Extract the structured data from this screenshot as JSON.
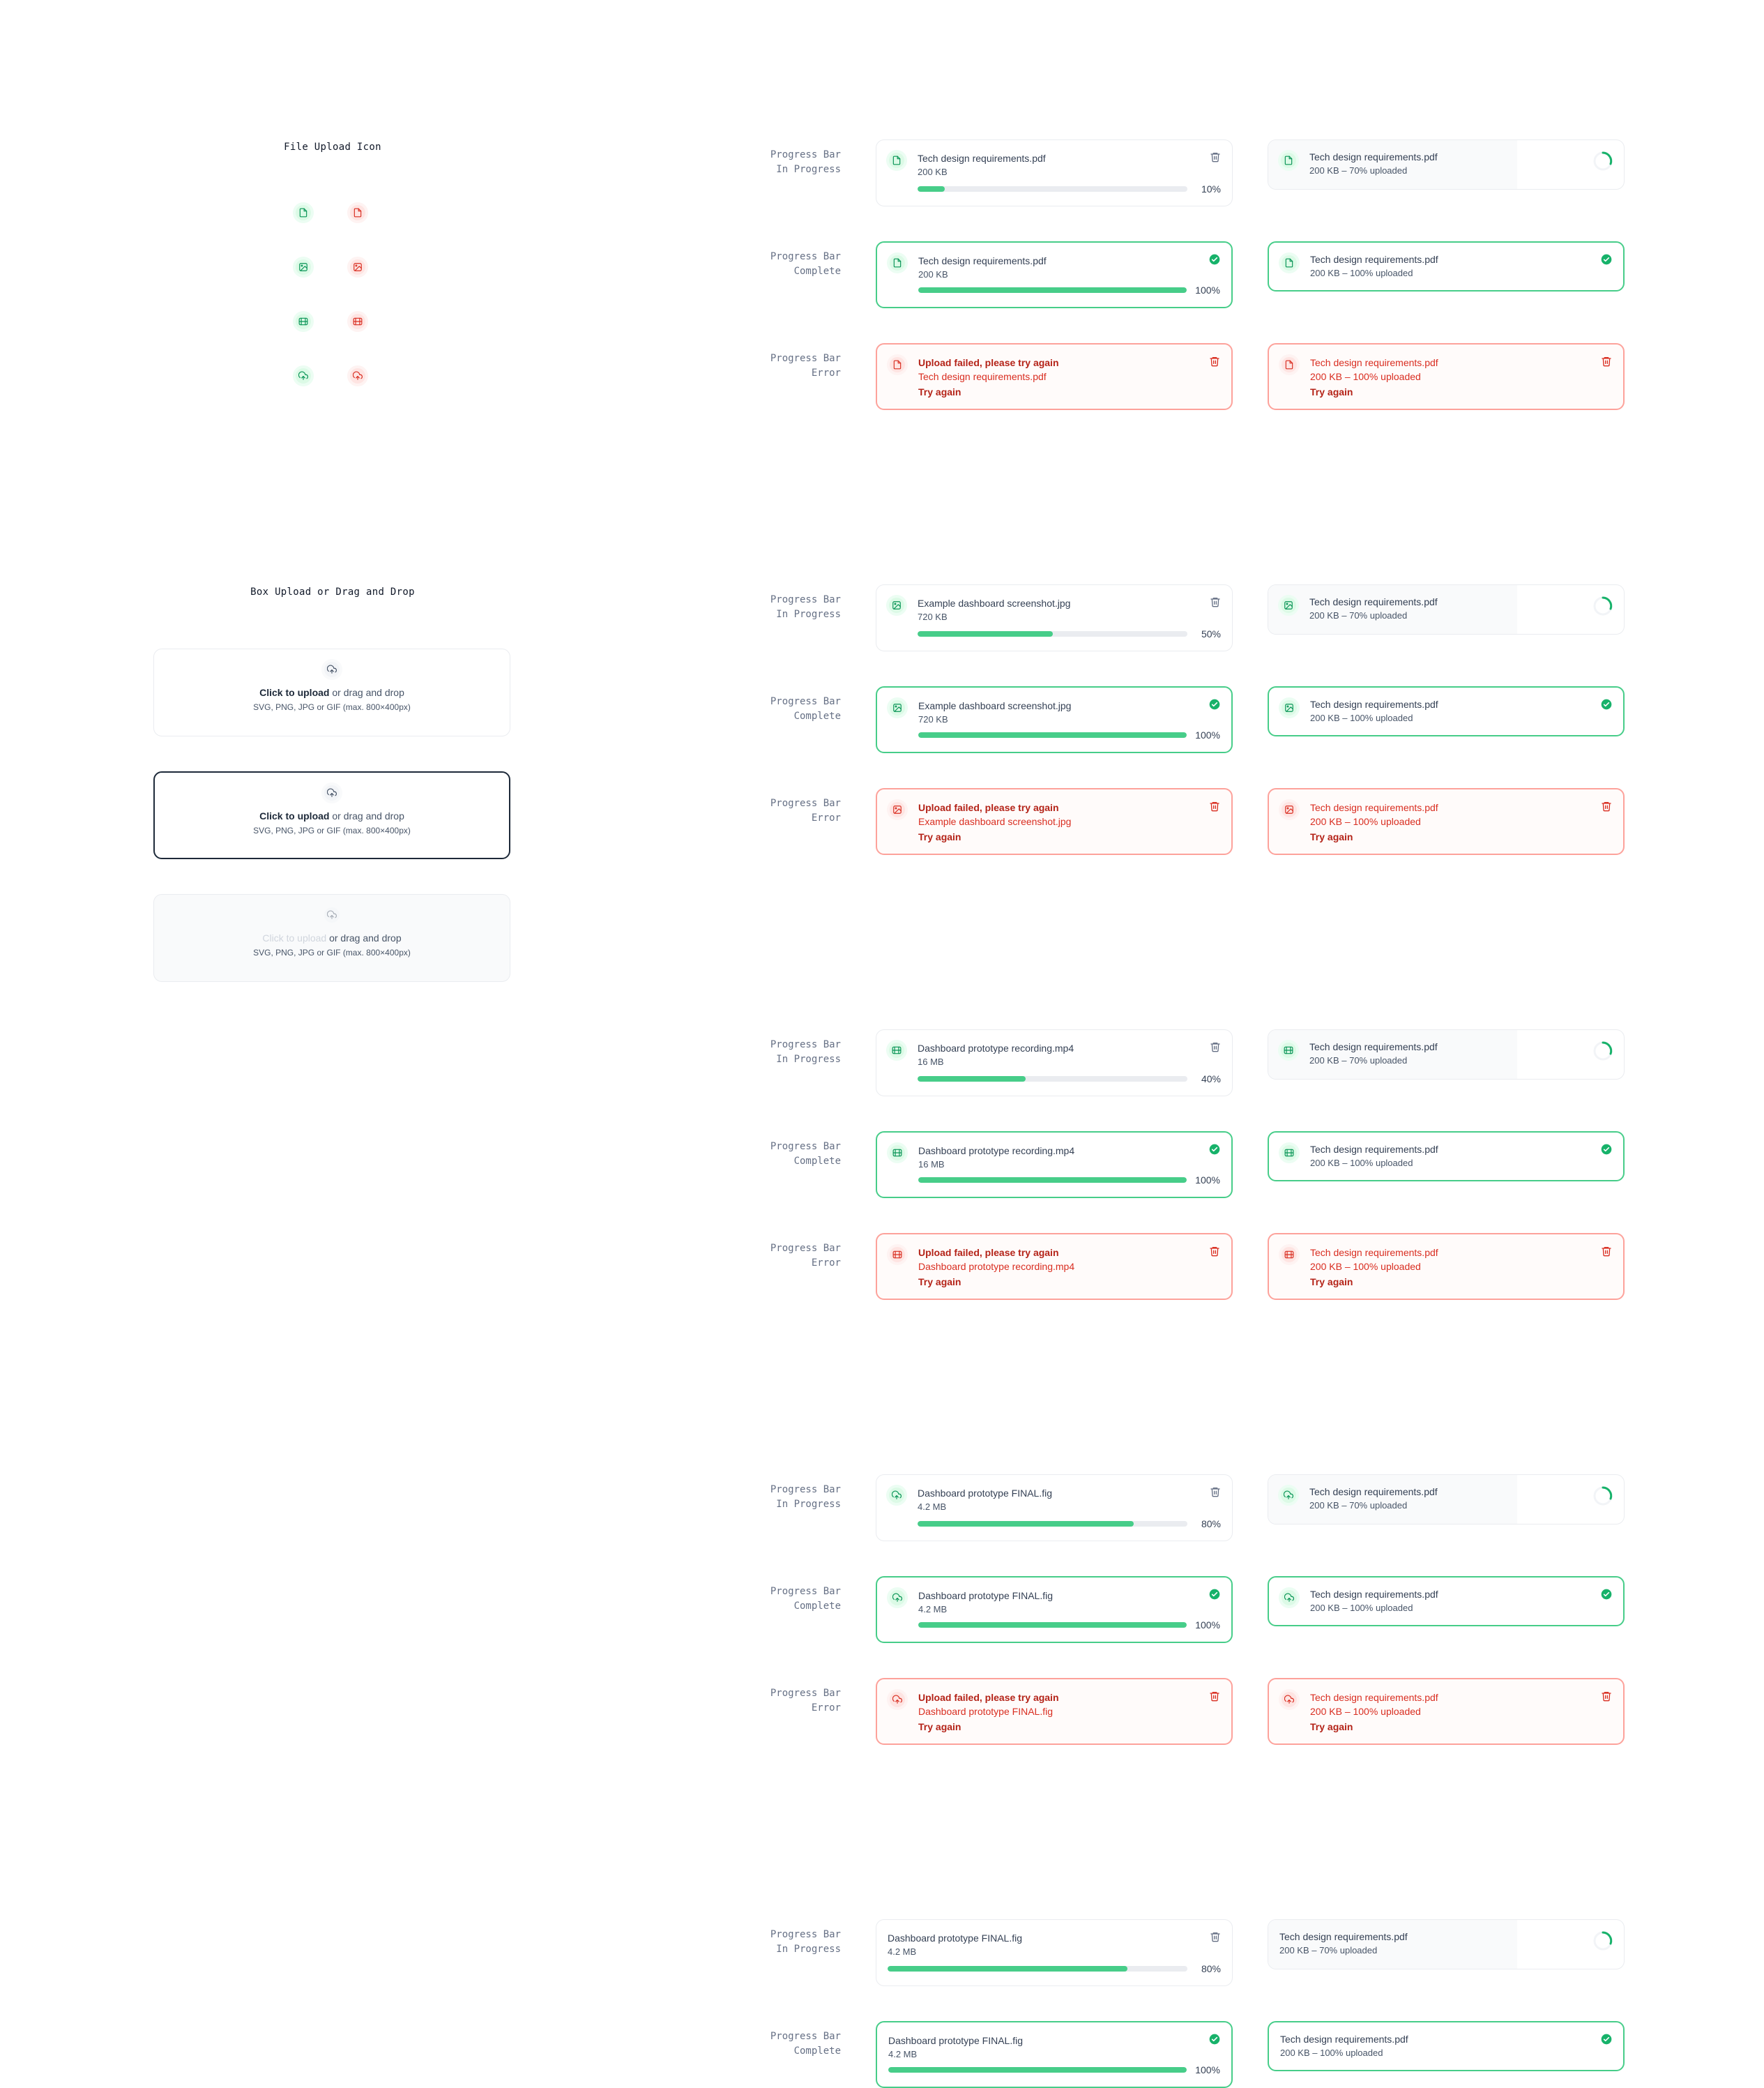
{
  "sections": {
    "icons_title": "File Upload Icon",
    "box_title": "Box Upload or Drag and Drop"
  },
  "icon_grid": [
    {
      "left": "file-icon",
      "right": "file-icon"
    },
    {
      "left": "image-icon",
      "right": "image-icon"
    },
    {
      "left": "video-icon",
      "right": "video-icon"
    },
    {
      "left": "upload-cloud-icon",
      "right": "upload-cloud-icon"
    }
  ],
  "dropzone": {
    "cta": "Click to upload",
    "rest": " or drag and drop",
    "hint": "SVG, PNG, JPG or GIF (max. 800×400px)"
  },
  "labels": {
    "in_progress": [
      "Progress Bar",
      "In Progress"
    ],
    "complete": [
      "Progress Bar",
      "Complete"
    ],
    "error": [
      "Progress Bar",
      "Error"
    ]
  },
  "groups": [
    {
      "icon": "file-icon",
      "file": "Tech design requirements.pdf",
      "size": "200 KB",
      "progress": "10%",
      "progress_value": 0.1,
      "error_title": "Upload failed, please try again",
      "error_file": "Tech design requirements.pdf"
    },
    {
      "icon": "image-icon",
      "file": "Example dashboard screenshot.jpg",
      "size": "720 KB",
      "progress": "50%",
      "progress_value": 0.5,
      "error_title": "Upload failed, please try again",
      "error_file": "Example dashboard screenshot.jpg"
    },
    {
      "icon": "video-icon",
      "file": "Dashboard prototype recording.mp4",
      "size": "16 MB",
      "progress": "40%",
      "progress_value": 0.4,
      "error_title": "Upload failed, please try again",
      "error_file": "Dashboard prototype recording.mp4"
    },
    {
      "icon": "upload-cloud-icon",
      "file": "Dashboard prototype FINAL.fig",
      "size": "4.2 MB",
      "progress": "80%",
      "progress_value": 0.8,
      "error_title": "Upload failed, please try again",
      "error_file": "Dashboard prototype FINAL.fig"
    },
    {
      "icon": "",
      "file": "Dashboard prototype FINAL.fig",
      "size": "4.2 MB",
      "progress": "80%",
      "progress_value": 0.8
    }
  ],
  "compact": {
    "file": "Tech design requirements.pdf",
    "in_progress_meta": "200 KB – 70% uploaded",
    "in_progress_value": 0.7,
    "complete_meta": "200 KB – 100% uploaded",
    "error_meta": "200 KB – 100% uploaded"
  },
  "complete_pct": "100%",
  "try_again": "Try again",
  "colors": {
    "success": "#47cd89",
    "error": "#d92d20",
    "text": "#344054",
    "focus_border": "#1d2939"
  }
}
